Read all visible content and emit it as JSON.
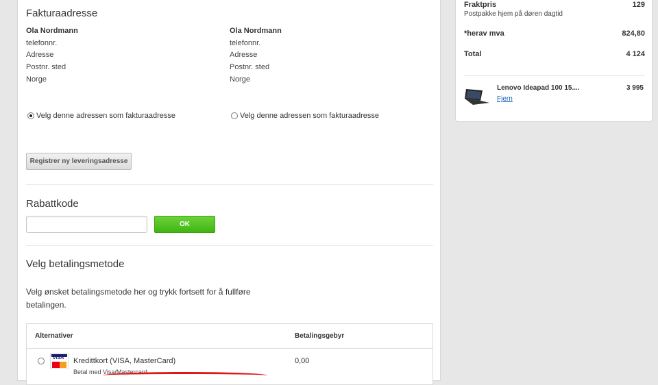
{
  "billing": {
    "title": "Fakturaadresse",
    "addresses": [
      {
        "name": "Ola Nordmann",
        "phone": "telefonnr.",
        "address": "Adresse",
        "postal": "Postnr. sted",
        "country": "Norge",
        "select_label": "Velg denne adressen som fakturaadresse",
        "selected": true
      },
      {
        "name": "Ola Nordmann",
        "phone": "telefonnr.",
        "address": "Adresse",
        "postal": "Postnr. sted",
        "country": "Norge",
        "select_label": "Velg denne adressen som fakturaadresse",
        "selected": false
      }
    ],
    "register_button": "Registrer ny leveringsadresse"
  },
  "discount": {
    "title": "Rabattkode",
    "input_value": "",
    "ok_button": "OK"
  },
  "payment": {
    "title": "Velg betalingsmetode",
    "description": "Velg ønsket betalingsmetode her og trykk fortsett for å fullføre betalingen.",
    "headers": {
      "alternatives": "Alternativer",
      "fee": "Betalingsgebyr"
    },
    "options": [
      {
        "label": "Kredittkort (VISA, MasterCard)",
        "sub": "Betal med Visa/Mastercard",
        "fee": "0,00",
        "icon": "visa-mastercard-icon"
      }
    ]
  },
  "summary": {
    "shipping_label": "Fraktpris",
    "shipping_value": "129",
    "shipping_desc": "Postpakke hjem på døren dagtid",
    "vat_label": "*herav mva",
    "vat_value": "824,80",
    "total_label": "Total",
    "total_value": "4 124",
    "product": {
      "name": "Lenovo Ideapad 100 15....",
      "price": "3 995",
      "remove": "Fjern",
      "icon": "laptop-icon"
    }
  },
  "colors": {
    "accent_green": "#4fc21f",
    "link": "#1a5fb4",
    "annotation_red": "#e01515"
  }
}
